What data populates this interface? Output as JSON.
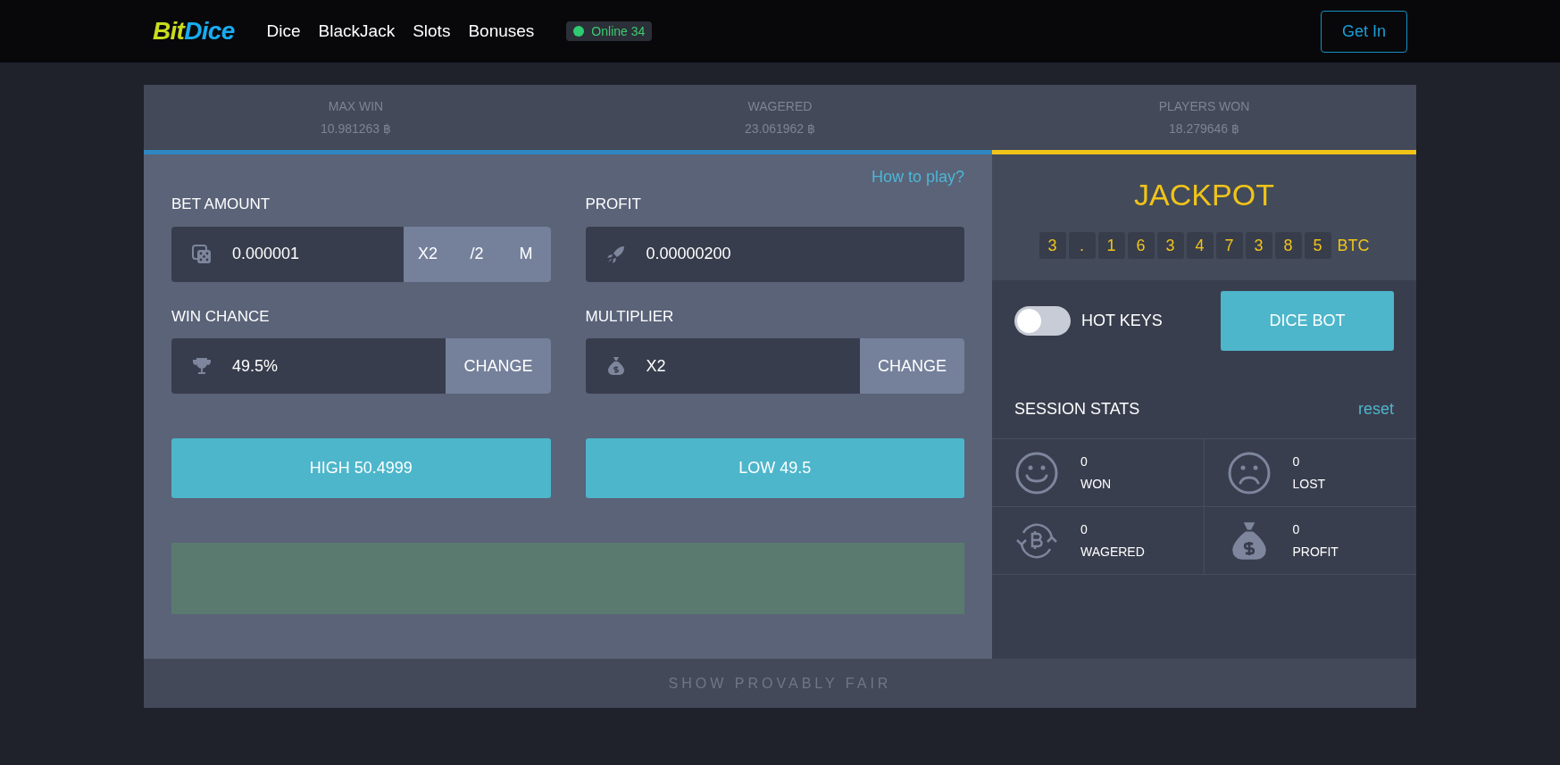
{
  "header": {
    "logo": {
      "part_1": "Bit",
      "part_2": "Dice"
    },
    "nav": [
      {
        "label": "Dice"
      },
      {
        "label": "BlackJack"
      },
      {
        "label": "Slots"
      },
      {
        "label": "Bonuses"
      }
    ],
    "online_badge": "Online 34",
    "login_button": "Get In"
  },
  "top_stats": [
    {
      "label": "MAX WIN",
      "value": "10.981263 ฿"
    },
    {
      "label": "WAGERED",
      "value": "23.061962 ฿"
    },
    {
      "label": "PLAYERS WON",
      "value": "18.279646 ฿"
    }
  ],
  "game": {
    "help_link": "How to play?",
    "fields": [
      {
        "kind": "buttons",
        "label": "BET AMOUNT",
        "value": "0.000001",
        "buttons": [
          "X2",
          "/2",
          "M"
        ]
      },
      {
        "kind": "plain",
        "label": "PROFIT",
        "value": "0.00000200"
      },
      {
        "kind": "buttons",
        "label": "WIN CHANCE",
        "value": "49.5%",
        "buttons": [
          "CHANGE"
        ]
      },
      {
        "kind": "buttons",
        "label": "MULTIPLIER",
        "value": "X2",
        "buttons": [
          "CHANGE"
        ]
      }
    ],
    "bet_buttons": [
      "HIGH 50.4999",
      "LOW 49.5"
    ]
  },
  "jackpot": {
    "title": "JACKPOT",
    "digits": [
      "3",
      ".",
      "1",
      "6",
      "3",
      "4",
      "7",
      "3",
      "8",
      "5"
    ],
    "unit": "BTC"
  },
  "hot_keys": {
    "label": "HOT KEYS",
    "on": false
  },
  "dice_bot_button": "DICE BOT",
  "session_stats": {
    "title": "SESSION STATS",
    "reset_link": "reset",
    "items": [
      {
        "value": "0",
        "label": "WON"
      },
      {
        "value": "0",
        "label": "LOST"
      },
      {
        "value": "0",
        "label": "WAGERED"
      },
      {
        "value": "0",
        "label": "PROFIT"
      }
    ]
  },
  "footer_button": "SHOW PROVABLY FAIR"
}
